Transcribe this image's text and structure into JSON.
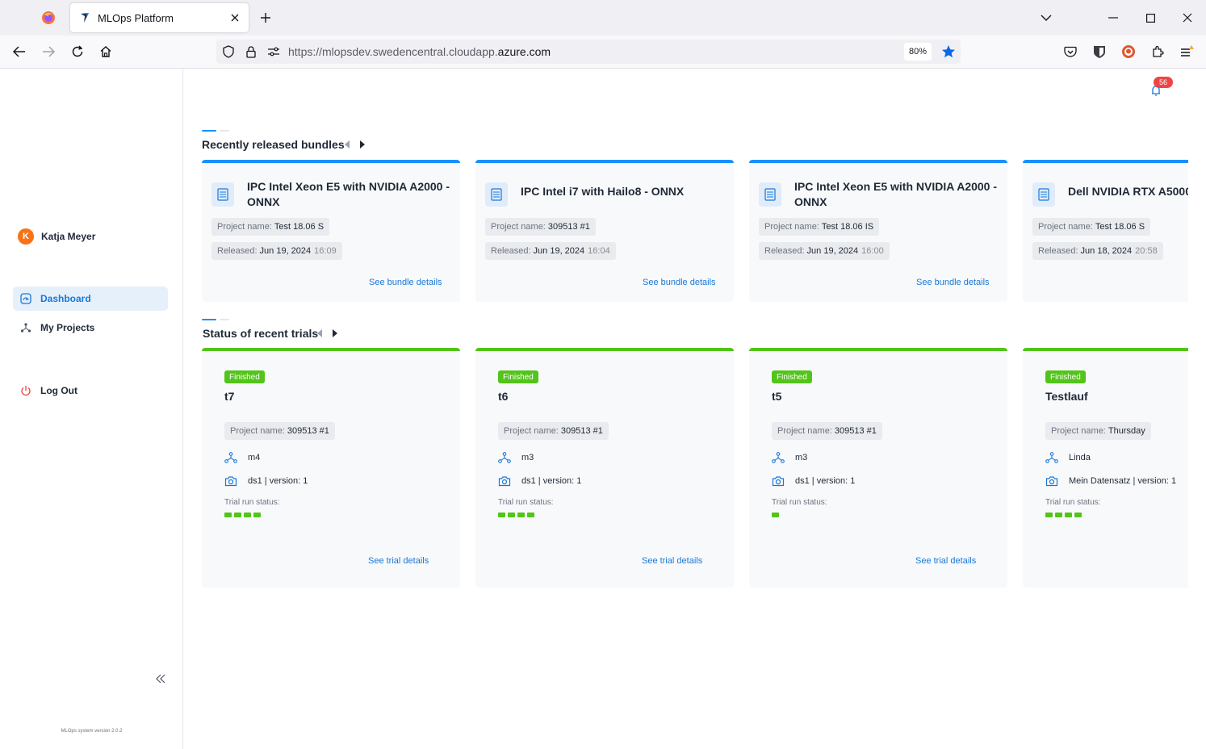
{
  "browser": {
    "tab_title": "MLOps Platform",
    "url_prefix": "https://mlopsdev.swedencentral.cloudapp.",
    "url_host": "azure.com",
    "zoom": "80%"
  },
  "sidebar": {
    "user_initial": "K",
    "user_name": "Katja Meyer",
    "items": [
      {
        "label": "Dashboard",
        "icon": "dashboard-icon",
        "active": true
      },
      {
        "label": "My Projects",
        "icon": "projects-icon",
        "active": false
      }
    ],
    "logout_label": "Log Out",
    "version": "MLOps system version 2.0.2"
  },
  "header": {
    "notification_count": "56"
  },
  "bundles": {
    "title": "Recently released bundles",
    "project_label": "Project name:",
    "released_label": "Released:",
    "link_label": "See bundle details",
    "items": [
      {
        "name": "IPC Intel Xeon E5 with NVIDIA A2000 - ONNX",
        "project": "Test 18.06 S",
        "date": "Jun 19, 2024",
        "time": "16:09"
      },
      {
        "name": "IPC Intel i7 with Hailo8 - ONNX",
        "project": "309513 #1",
        "date": "Jun 19, 2024",
        "time": "16:04"
      },
      {
        "name": "IPC Intel Xeon E5 with NVIDIA A2000 - ONNX",
        "project": "Test 18.06 IS",
        "date": "Jun 19, 2024",
        "time": "16:00"
      },
      {
        "name": "Dell NVIDIA RTX A5000",
        "project": "Test 18.06 S",
        "date": "Jun 18, 2024",
        "time": "20:58"
      }
    ]
  },
  "trials": {
    "title": "Status of recent trials",
    "project_label": "Project name:",
    "status_label": "Trial run status:",
    "link_label": "See trial details",
    "items": [
      {
        "status": "Finished",
        "name": "t7",
        "project": "309513 #1",
        "model": "m4",
        "dataset": "ds1 | version: 1",
        "runs": 4
      },
      {
        "status": "Finished",
        "name": "t6",
        "project": "309513 #1",
        "model": "m3",
        "dataset": "ds1 | version: 1",
        "runs": 4
      },
      {
        "status": "Finished",
        "name": "t5",
        "project": "309513 #1",
        "model": "m3",
        "dataset": "ds1 | version: 1",
        "runs": 1
      },
      {
        "status": "Finished",
        "name": "Testlauf",
        "project": "Thursday",
        "model": "Linda",
        "dataset": "Mein Datensatz | version: 1",
        "runs": 4
      }
    ]
  }
}
